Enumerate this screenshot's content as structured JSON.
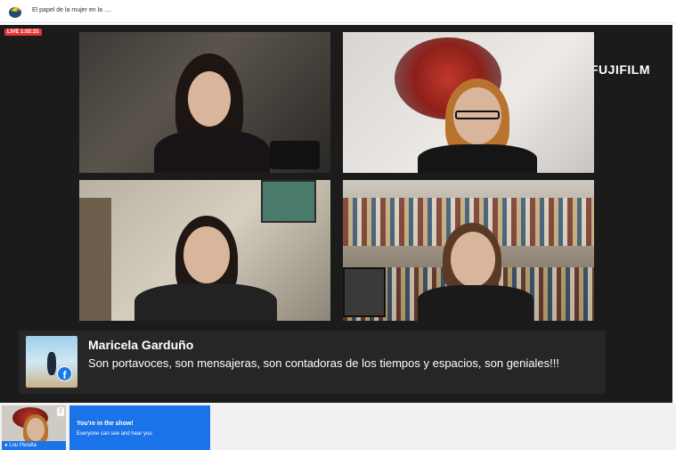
{
  "header": {
    "title": "El papel de la mujer en la ...."
  },
  "stage": {
    "live_badge": "LIVE 1:02:31",
    "brand": "FUJIFILM"
  },
  "comment": {
    "author": "Maricela Garduño",
    "text": "Son portavoces, son mensajeras, son contadoras de los tiempos y espacios, son geniales!!!",
    "platform_icon": "facebook-icon"
  },
  "self_view": {
    "name": "Lou Peralta",
    "menu": "⋮"
  },
  "status_card": {
    "title": "You're in the show!",
    "subtitle": "Everyone can see and hear you"
  },
  "colors": {
    "accent": "#1a73e8",
    "live": "#e53935",
    "stage": "#1b1b1b"
  }
}
